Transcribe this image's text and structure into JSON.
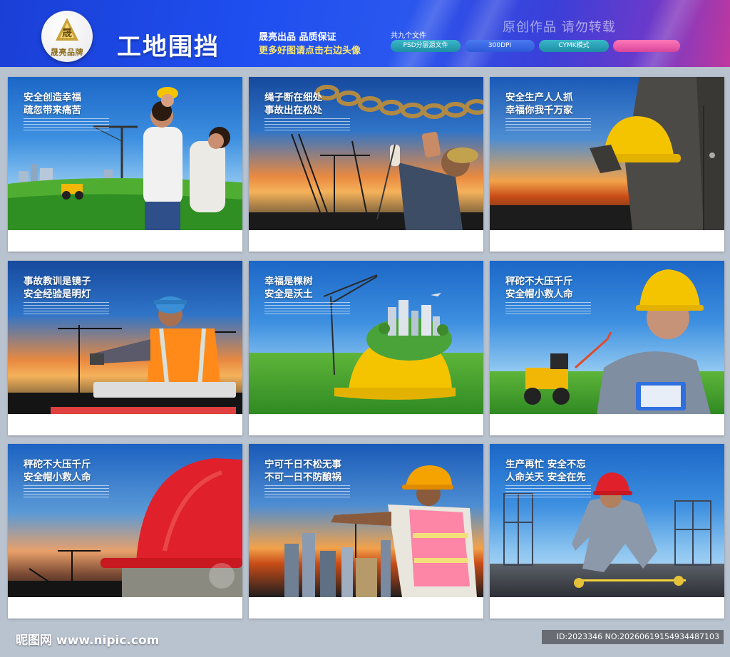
{
  "header": {
    "logo_text": "晟亮品牌",
    "title": "工地围挡",
    "slogan_line1": "晟亮出品 品质保证",
    "slogan_line2": "更多好图请点击右边头像",
    "files_count": "共九个文件",
    "tags": [
      "PSD分层源文件",
      "300DPI",
      "CYMK模式"
    ],
    "original_notice": "原创作品 请勿转载"
  },
  "panels": [
    {
      "line1": "安全创造幸福",
      "line2": "疏忽带来痛苦",
      "scene": "family-crane"
    },
    {
      "line1": "绳子断在细处",
      "line2": "事故出在松处",
      "scene": "chain-welder"
    },
    {
      "line1": "安全生产人人抓",
      "line2": "幸福你我千万家",
      "scene": "helmet-hold"
    },
    {
      "line1": "事故教训是镜子",
      "line2": "安全经验是明灯",
      "scene": "vest-worker"
    },
    {
      "line1": "幸福是棵树",
      "line2": "安全是沃土",
      "scene": "helmet-city"
    },
    {
      "line1": "秤砣不大压千斤",
      "line2": "安全帽小救人命",
      "scene": "clipboard-worker"
    },
    {
      "line1": "秤砣不大压千斤",
      "line2": "安全帽小救人命",
      "scene": "red-helmet"
    },
    {
      "line1": "宁可千日不松无事",
      "line2": "不可一日不防酿祸",
      "scene": "pointing-worker"
    },
    {
      "line1": "生产再忙 安全不忘",
      "line2": "人命关天 安全在先",
      "scene": "measuring-worker"
    }
  ],
  "footer": {
    "site_name": "昵图网 www.nipic.com",
    "id_text": "ID:2023346 NO:20260619154934487103"
  },
  "colors": {
    "header_blue": "#1f4ff0",
    "header_pink": "#c0389e",
    "page_bg": "#b9c2cf",
    "tag_teal": "#2aa3b8",
    "helmet_yellow": "#f5c400",
    "helmet_red": "#e0202a"
  }
}
